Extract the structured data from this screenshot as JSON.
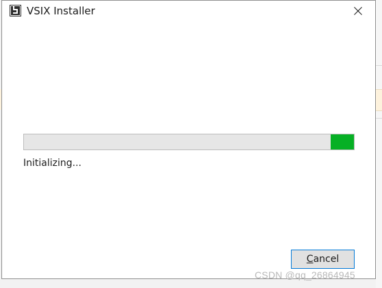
{
  "window": {
    "title": "VSIX Installer",
    "app_icon": "vsix-installer-icon",
    "close_icon": "close-icon"
  },
  "progress": {
    "value_fraction": 0.07,
    "position": "right",
    "color": "#06b025",
    "status_text": "Initializing..."
  },
  "buttons": {
    "cancel_mnemonic": "C",
    "cancel_rest": "ancel"
  },
  "watermark": {
    "text": "CSDN @qq_26864945"
  },
  "colors": {
    "accent": "#0078d7",
    "progress_track": "#e6e6e6"
  }
}
